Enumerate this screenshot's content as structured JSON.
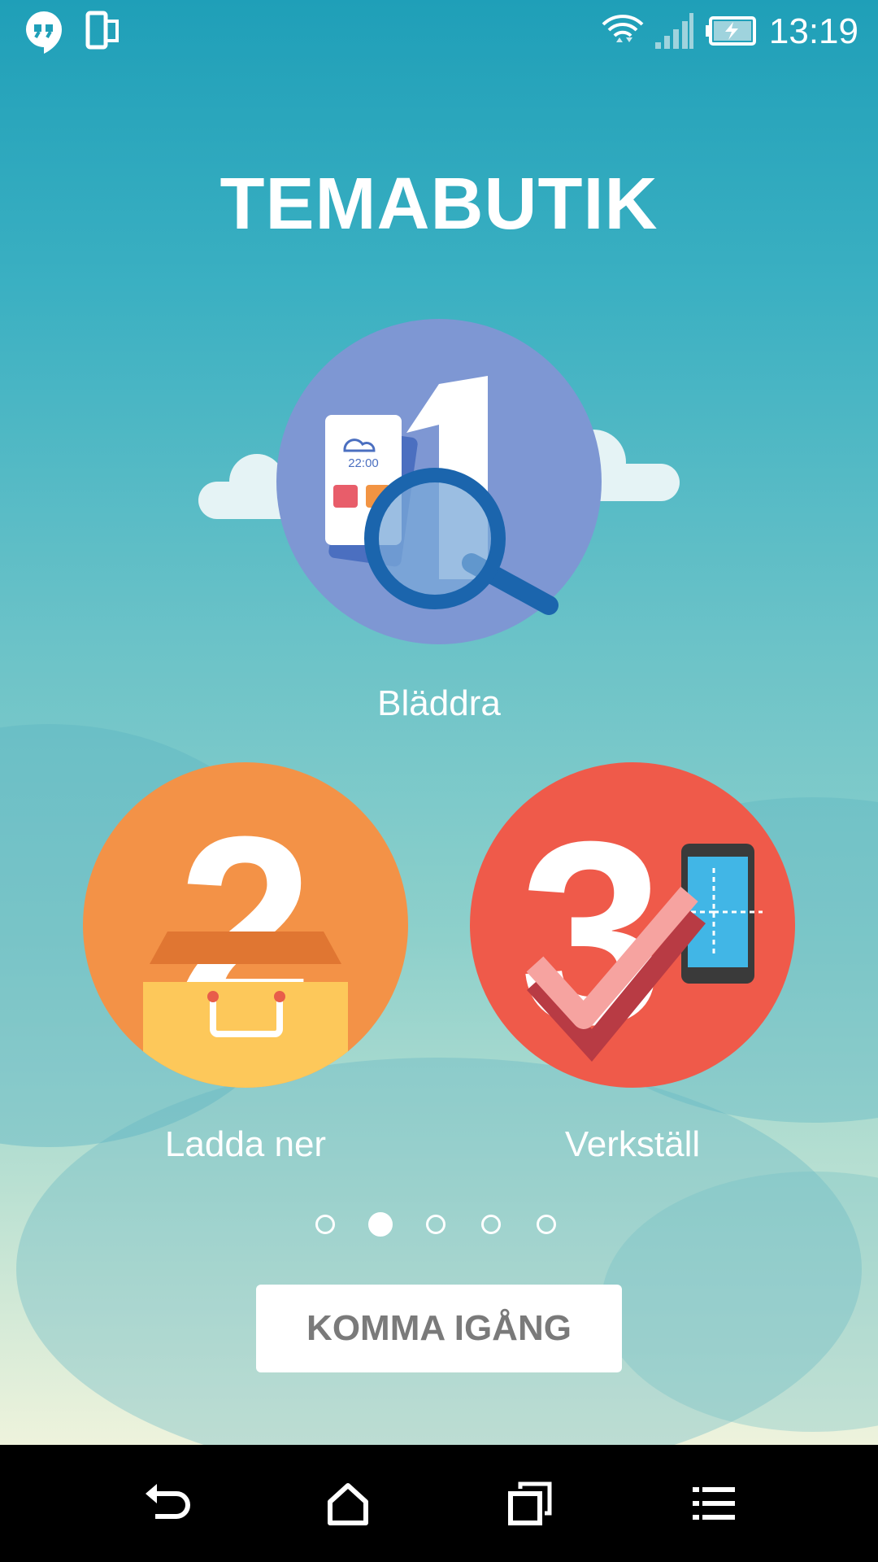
{
  "status_bar": {
    "time": "13:19",
    "icons": [
      "hangouts-icon",
      "device-icon",
      "wifi-icon",
      "signal-icon",
      "battery-charging-icon"
    ]
  },
  "title": "TEMABUTIK",
  "steps": [
    {
      "label": "Bläddra",
      "illustration": "browse-magnifier-icon",
      "number": "1",
      "clock_text": "22:00",
      "color": "#7e97d3"
    },
    {
      "label": "Ladda ner",
      "illustration": "shopping-bag-icon",
      "number": "2",
      "color": "#f39247"
    },
    {
      "label": "Verkställ",
      "illustration": "apply-checkmark-icon",
      "number": "3",
      "color": "#ef5a4a"
    }
  ],
  "pager": {
    "count": 5,
    "active_index": 1
  },
  "get_started_label": "KOMMA IGÅNG",
  "nav_bar": {
    "icons": [
      "back-icon",
      "home-icon",
      "recents-icon",
      "menu-icon"
    ]
  }
}
